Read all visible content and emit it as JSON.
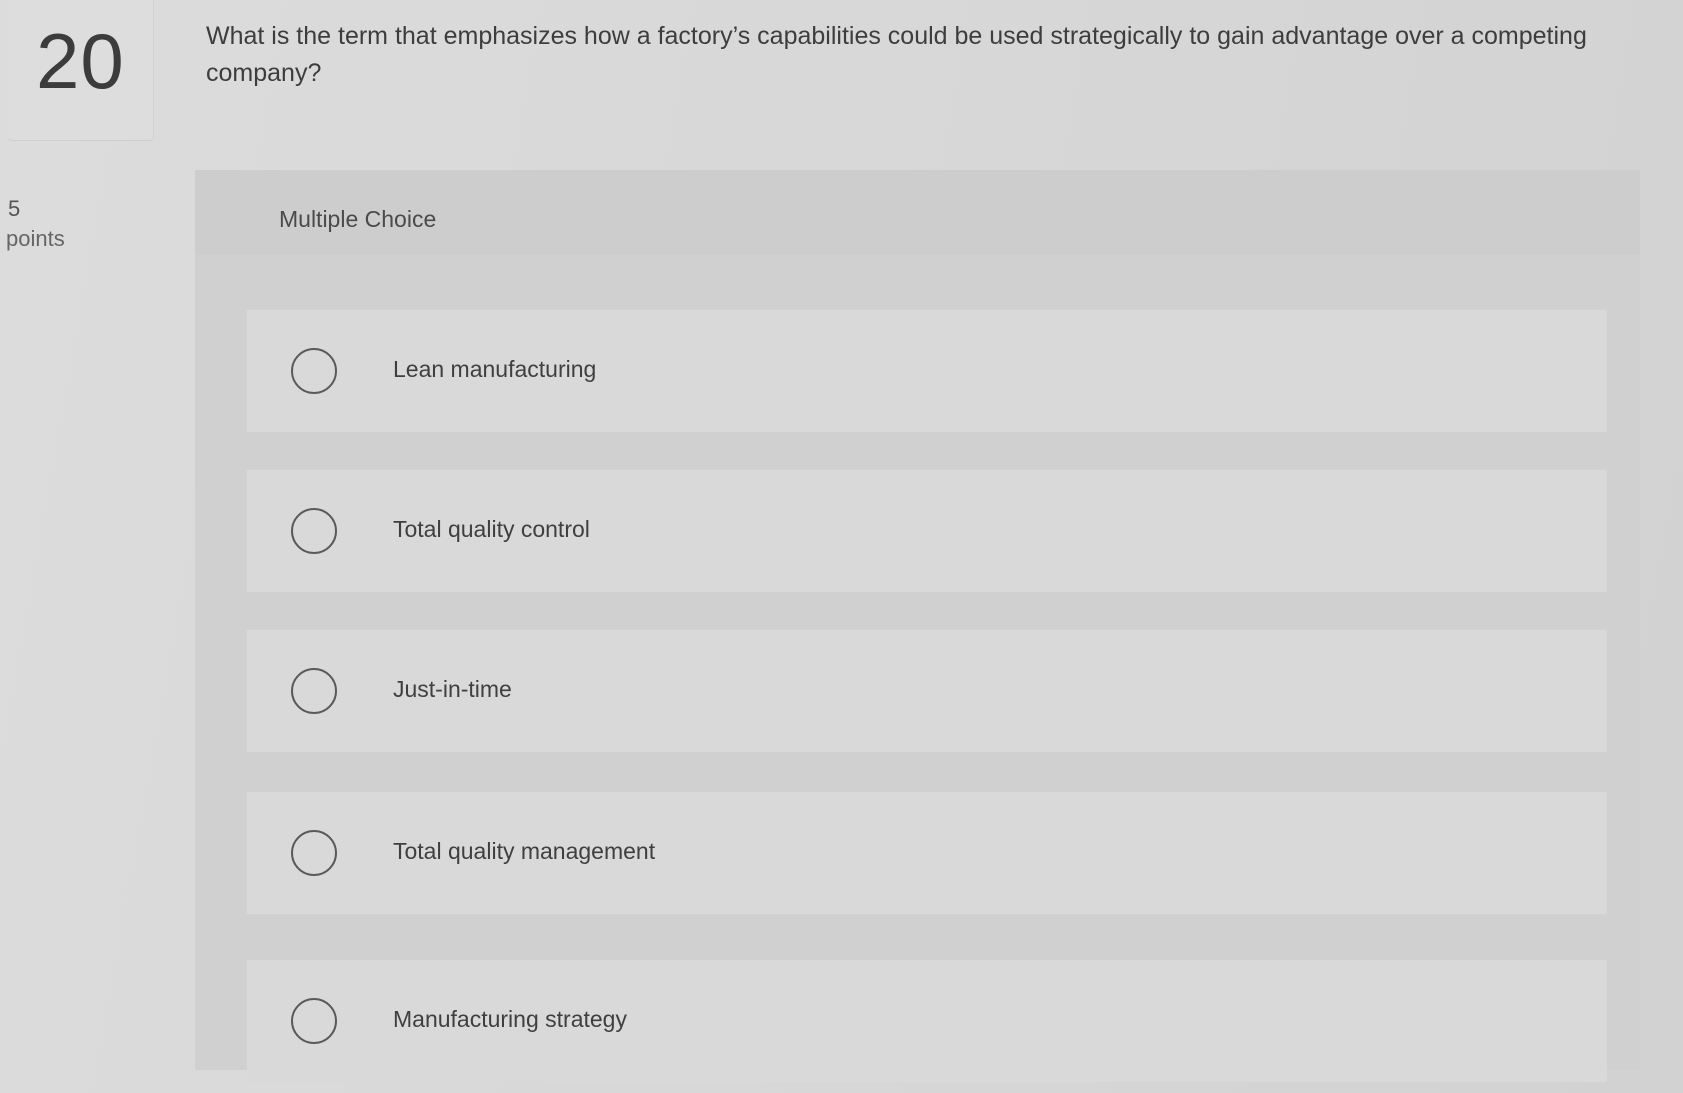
{
  "question": {
    "number": "20",
    "points_value": "5",
    "points_label": "points",
    "text": "What is the term that emphasizes how a factory’s capabilities could be used strategically to gain advantage over a competing company?"
  },
  "panel": {
    "title": "Multiple Choice"
  },
  "options": [
    {
      "label": "Lean manufacturing",
      "selected": false
    },
    {
      "label": "Total quality control",
      "selected": false
    },
    {
      "label": "Just-in-time",
      "selected": false
    },
    {
      "label": "Total quality management",
      "selected": false
    },
    {
      "label": "Manufacturing strategy",
      "selected": false
    }
  ]
}
